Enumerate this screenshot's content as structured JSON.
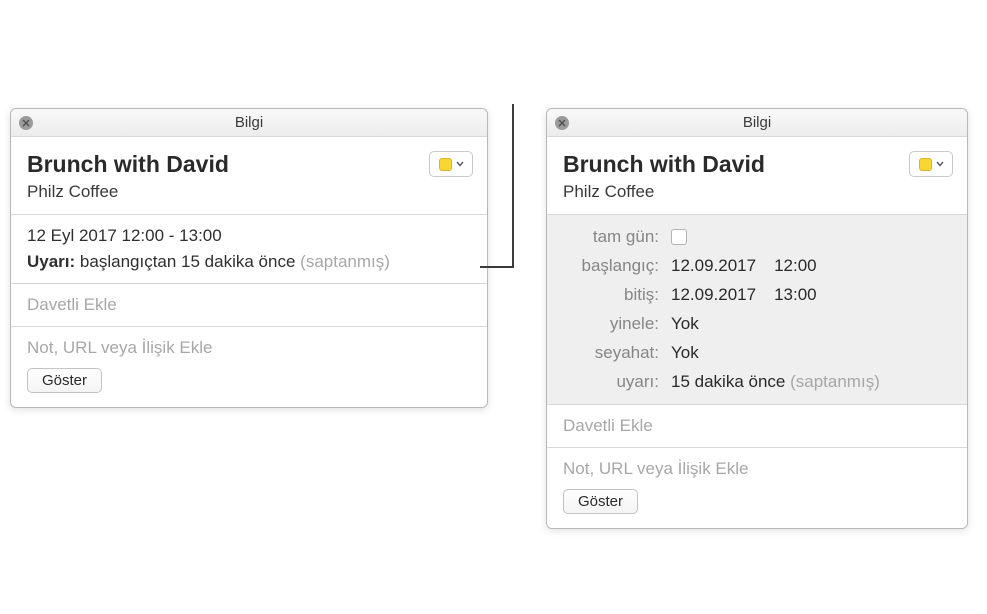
{
  "colors": {
    "calendar": "#f9d733"
  },
  "left": {
    "title": "Bilgi",
    "event_title": "Brunch with David",
    "event_location": "Philz Coffee",
    "datetime": "12 Eyl 2017  12:00 - 13:00",
    "alert_label": "Uyarı:",
    "alert_value": "başlangıçtan 15 dakika önce",
    "alert_default": "(saptanmış)",
    "add_invitees": "Davetli Ekle",
    "add_notes": "Not, URL veya İlişik Ekle",
    "show_btn": "Göster"
  },
  "right": {
    "title": "Bilgi",
    "event_title": "Brunch with David",
    "event_location": "Philz Coffee",
    "rows": {
      "allday_label": "tam gün:",
      "start_label": "başlangıç:",
      "start_date": "12.09.2017",
      "start_time": "12:00",
      "end_label": "bitiş:",
      "end_date": "12.09.2017",
      "end_time": "13:00",
      "repeat_label": "yinele:",
      "repeat_value": "Yok",
      "travel_label": "seyahat:",
      "travel_value": "Yok",
      "alert_label": "uyarı:",
      "alert_value": "15 dakika önce",
      "alert_default": "(saptanmış)"
    },
    "add_invitees": "Davetli Ekle",
    "add_notes": "Not, URL veya İlişik Ekle",
    "show_btn": "Göster"
  }
}
